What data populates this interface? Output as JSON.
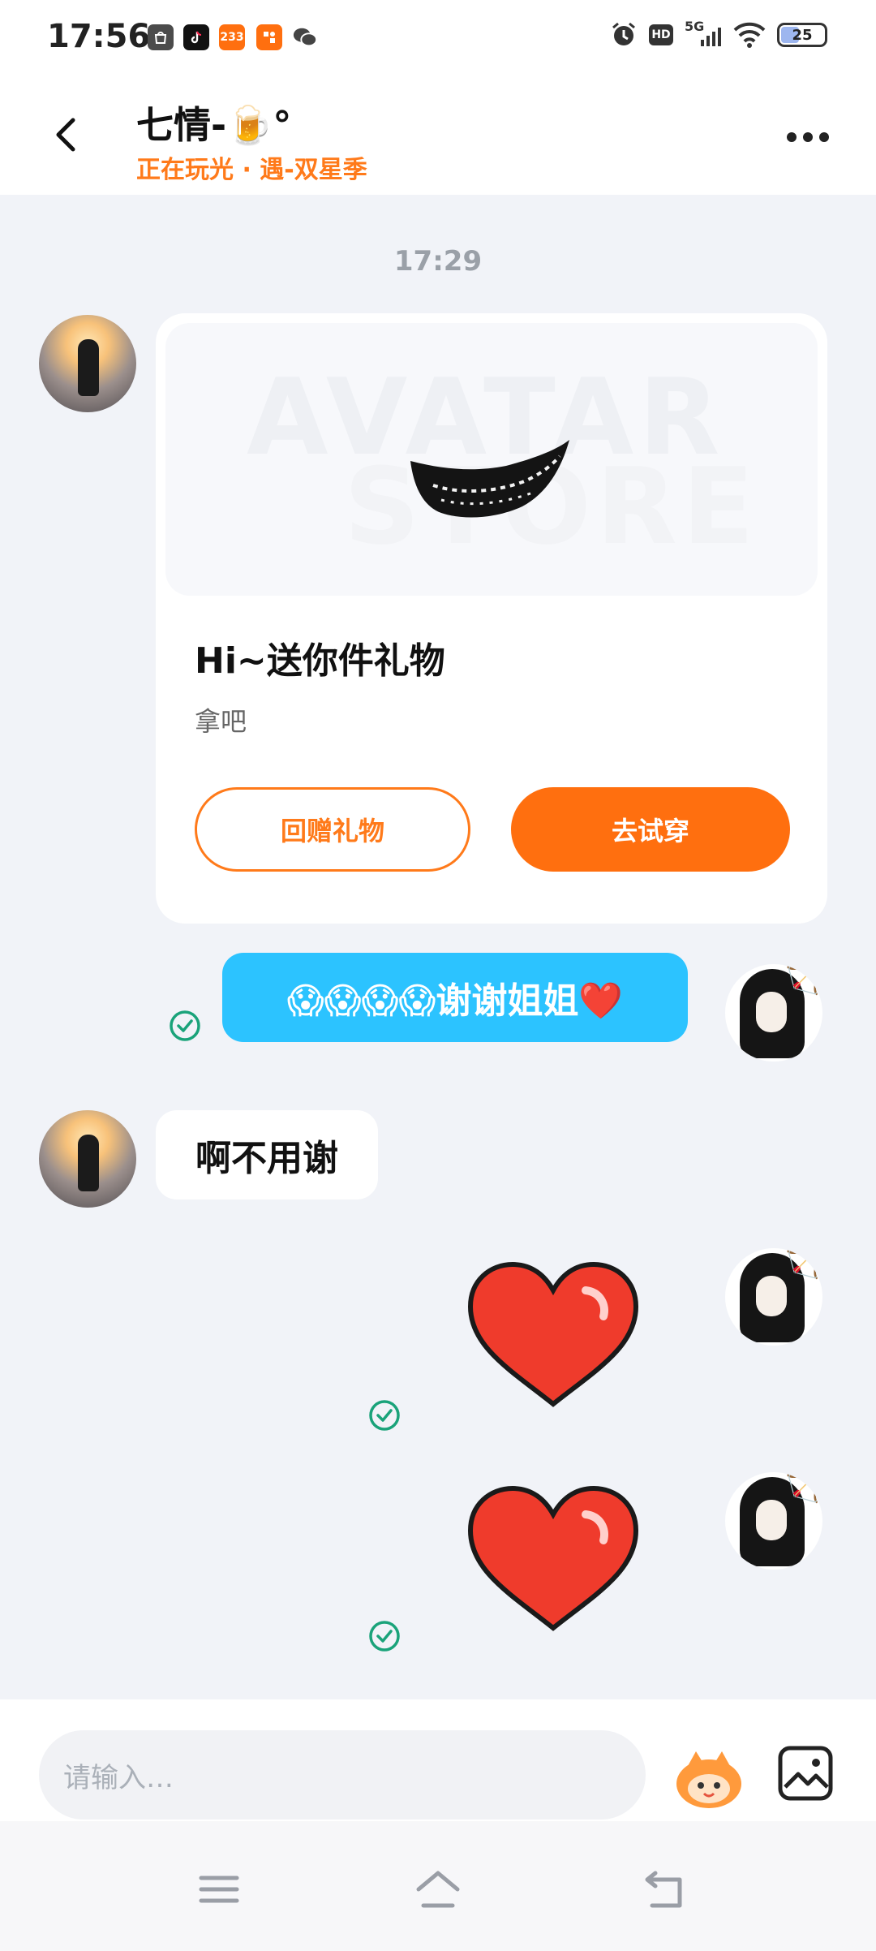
{
  "status_bar": {
    "time": "17:56",
    "app_icons": [
      "shopee-icon",
      "tiktok-icon",
      "233-icon",
      "app-icon",
      "wechat-icon"
    ],
    "app_icon_233": "233",
    "sys": {
      "alarm": "alarm-icon",
      "hd": "HD",
      "network": "5G",
      "wifi": "wifi-icon",
      "battery": "25"
    }
  },
  "header": {
    "title": "七情-🍺°",
    "subtitle": "正在玩光 · 遇-双星季"
  },
  "chat": {
    "timestamp": "17:29",
    "gift_card": {
      "watermark_line1": "AVATAR",
      "watermark_line2": "STORE",
      "title": "Hi~送你件礼物",
      "subtitle": "拿吧",
      "button_return": "回赠礼物",
      "button_try": "去试穿"
    },
    "messages": [
      {
        "side": "right",
        "text": "😱😱😱😱谢谢姐姐❤️"
      },
      {
        "side": "left",
        "text": "啊不用谢"
      }
    ]
  },
  "input_bar": {
    "placeholder": "请输入…"
  },
  "colors": {
    "accent": "#ff7a1a",
    "bubble_blue": "#2cc3ff",
    "background": "#f1f3f8",
    "check": "#1aa37a"
  }
}
